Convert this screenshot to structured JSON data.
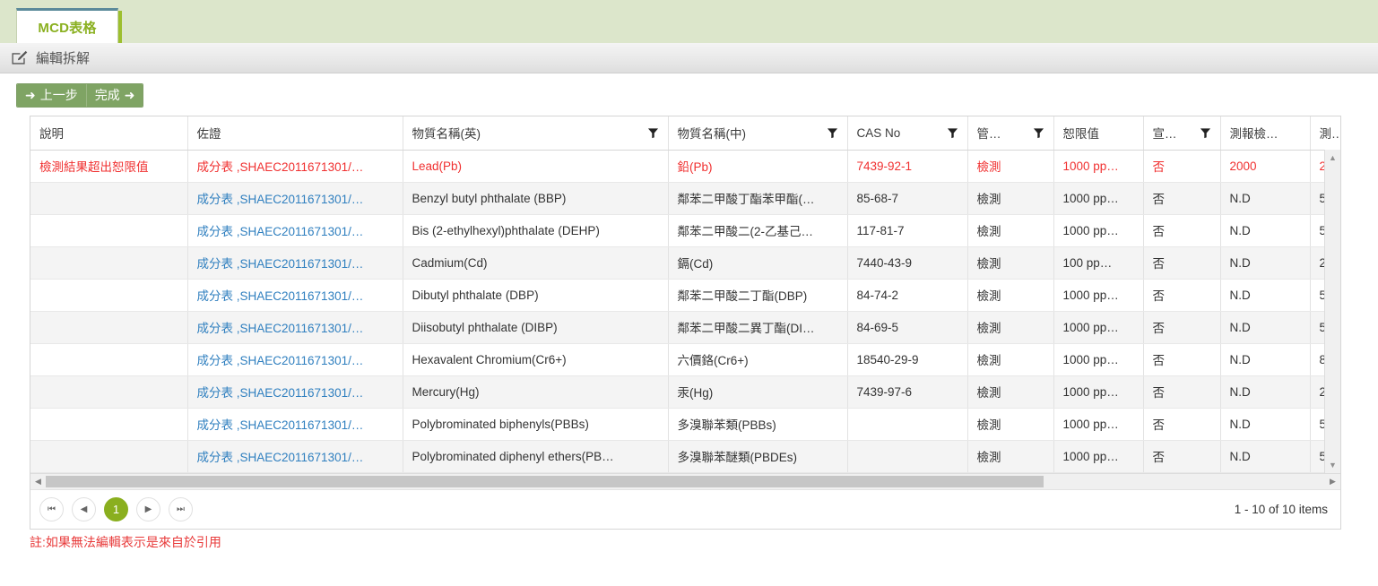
{
  "tab": {
    "label": "MCD表格"
  },
  "editbar": {
    "label": "編輯拆解",
    "icon": "pencil-edit-icon"
  },
  "toolbar": {
    "prev_label": "上一步",
    "prev_icon": "arrow-left-icon",
    "done_label": "完成",
    "done_icon": "arrow-right-icon"
  },
  "grid": {
    "columns": [
      {
        "label": "說明",
        "filter": false
      },
      {
        "label": "佐證",
        "filter": false
      },
      {
        "label": "物質名稱(英)",
        "filter": true
      },
      {
        "label": "物質名稱(中)",
        "filter": true
      },
      {
        "label": "CAS No",
        "filter": true
      },
      {
        "label": "管…",
        "filter": true
      },
      {
        "label": "恕限值",
        "filter": false
      },
      {
        "label": "宣…",
        "filter": true
      },
      {
        "label": "測報檢…",
        "filter": false
      },
      {
        "label": "測…",
        "filter": false
      }
    ],
    "rows": [
      {
        "warn": true,
        "desc": "檢測結果超出恕限值",
        "evidence": "成分表 ,SHAEC2011671301/…",
        "name_en": "Lead(Pb)",
        "name_zh": "鉛(Pb)",
        "cas": "7439-92-1",
        "ctrl": "檢測",
        "limit": "1000 pp…",
        "declare": "否",
        "report": "2000",
        "last": "2"
      },
      {
        "warn": false,
        "desc": "",
        "evidence": "成分表 ,SHAEC2011671301/…",
        "name_en": "Benzyl butyl phthalate (BBP)",
        "name_zh": "鄰苯二甲酸丁酯苯甲酯(…",
        "cas": "85-68-7",
        "ctrl": "檢測",
        "limit": "1000 pp…",
        "declare": "否",
        "report": "N.D",
        "last": "5"
      },
      {
        "warn": false,
        "desc": "",
        "evidence": "成分表 ,SHAEC2011671301/…",
        "name_en": "Bis (2-ethylhexyl)phthalate (DEHP)",
        "name_zh": "鄰苯二甲酸二(2-乙基己…",
        "cas": "117-81-7",
        "ctrl": "檢測",
        "limit": "1000 pp…",
        "declare": "否",
        "report": "N.D",
        "last": "5"
      },
      {
        "warn": false,
        "desc": "",
        "evidence": "成分表 ,SHAEC2011671301/…",
        "name_en": "Cadmium(Cd)",
        "name_zh": "鎘(Cd)",
        "cas": "7440-43-9",
        "ctrl": "檢測",
        "limit": "100 pp…",
        "declare": "否",
        "report": "N.D",
        "last": "2"
      },
      {
        "warn": false,
        "desc": "",
        "evidence": "成分表 ,SHAEC2011671301/…",
        "name_en": "Dibutyl phthalate (DBP)",
        "name_zh": "鄰苯二甲酸二丁酯(DBP)",
        "cas": "84-74-2",
        "ctrl": "檢測",
        "limit": "1000 pp…",
        "declare": "否",
        "report": "N.D",
        "last": "5"
      },
      {
        "warn": false,
        "desc": "",
        "evidence": "成分表 ,SHAEC2011671301/…",
        "name_en": "Diisobutyl phthalate (DIBP)",
        "name_zh": "鄰苯二甲酸二異丁酯(DI…",
        "cas": "84-69-5",
        "ctrl": "檢測",
        "limit": "1000 pp…",
        "declare": "否",
        "report": "N.D",
        "last": "5"
      },
      {
        "warn": false,
        "desc": "",
        "evidence": "成分表 ,SHAEC2011671301/…",
        "name_en": "Hexavalent Chromium(Cr6+)",
        "name_zh": "六價鉻(Cr6+)",
        "cas": "18540-29-9",
        "ctrl": "檢測",
        "limit": "1000 pp…",
        "declare": "否",
        "report": "N.D",
        "last": "8"
      },
      {
        "warn": false,
        "desc": "",
        "evidence": "成分表 ,SHAEC2011671301/…",
        "name_en": "Mercury(Hg)",
        "name_zh": "汞(Hg)",
        "cas": "7439-97-6",
        "ctrl": "檢測",
        "limit": "1000 pp…",
        "declare": "否",
        "report": "N.D",
        "last": "2"
      },
      {
        "warn": false,
        "desc": "",
        "evidence": "成分表 ,SHAEC2011671301/…",
        "name_en": "Polybrominated biphenyls(PBBs)",
        "name_zh": "多溴聯苯類(PBBs)",
        "cas": "",
        "ctrl": "檢測",
        "limit": "1000 pp…",
        "declare": "否",
        "report": "N.D",
        "last": "5"
      },
      {
        "warn": false,
        "desc": "",
        "evidence": "成分表 ,SHAEC2011671301/…",
        "name_en": "Polybrominated diphenyl ethers(PB…",
        "name_zh": "多溴聯苯醚類(PBDEs)",
        "cas": "",
        "ctrl": "檢測",
        "limit": "1000 pp…",
        "declare": "否",
        "report": "N.D",
        "last": "5"
      }
    ]
  },
  "pager": {
    "first_icon": "go-to-first-page-icon",
    "prev_icon": "previous-page-icon",
    "current_page": "1",
    "next_icon": "next-page-icon",
    "last_icon": "go-to-last-page-icon",
    "info": "1 - 10 of 10 items"
  },
  "note": "註:如果無法編輯表示是來自於引用",
  "colors": {
    "tab_strip": "#dce6cb",
    "tab_text": "#8ab020",
    "accent_green": "#7fa464",
    "pager_active": "#8aaf1f",
    "warn_red": "#f03030",
    "link_blue": "#2f7fbf"
  }
}
